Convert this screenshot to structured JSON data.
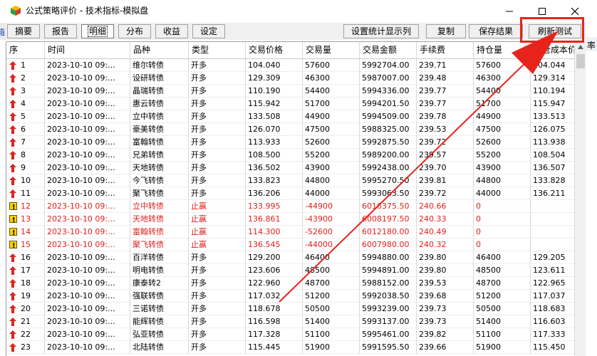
{
  "window": {
    "title": "公式策略评价 - 技术指标-模拟盘",
    "left_fragment": "箱",
    "right_fragment": "率"
  },
  "toolbar": {
    "tabs": [
      "摘要",
      "报告",
      "明细",
      "分布",
      "收益",
      "设定"
    ],
    "active_tab": "明细",
    "buttons": [
      "设置统计显示列",
      "复制",
      "保存结果",
      "刷新测试"
    ]
  },
  "table": {
    "columns": [
      "序",
      "时间",
      "品种",
      "类型",
      "交易价格",
      "交易量",
      "交易金额",
      "手续费",
      "持仓量",
      "持仓成本价"
    ],
    "rows": [
      {
        "icon": "up-arrow",
        "seq": "1",
        "time": "2023-10-10 09:...",
        "name": "维尔转债",
        "type": "开多",
        "price": "104.040",
        "volume": "57600",
        "amount": "5992704.00",
        "fee": "239.71",
        "position": "57600",
        "cost": "104.044",
        "red": false
      },
      {
        "icon": "up-arrow",
        "seq": "2",
        "time": "2023-10-10 09:...",
        "name": "设研转债",
        "type": "开多",
        "price": "129.309",
        "volume": "46300",
        "amount": "5987007.00",
        "fee": "239.48",
        "position": "46300",
        "cost": "129.314",
        "red": false
      },
      {
        "icon": "up-arrow",
        "seq": "3",
        "time": "2023-10-10 09:...",
        "name": "晶瑞转债",
        "type": "开多",
        "price": "110.190",
        "volume": "54400",
        "amount": "5994336.00",
        "fee": "239.77",
        "position": "54400",
        "cost": "110.194",
        "red": false
      },
      {
        "icon": "up-arrow",
        "seq": "4",
        "time": "2023-10-10 09:...",
        "name": "惠云转债",
        "type": "开多",
        "price": "115.942",
        "volume": "51700",
        "amount": "5994201.50",
        "fee": "239.77",
        "position": "51700",
        "cost": "115.947",
        "red": false
      },
      {
        "icon": "up-arrow",
        "seq": "5",
        "time": "2023-10-10 09:...",
        "name": "立中转债",
        "type": "开多",
        "price": "133.508",
        "volume": "44900",
        "amount": "5994509.00",
        "fee": "239.78",
        "position": "44900",
        "cost": "133.513",
        "red": false
      },
      {
        "icon": "up-arrow",
        "seq": "6",
        "time": "2023-10-10 09:...",
        "name": "豪美转债",
        "type": "开多",
        "price": "126.070",
        "volume": "47500",
        "amount": "5988325.00",
        "fee": "239.53",
        "position": "47500",
        "cost": "126.075",
        "red": false
      },
      {
        "icon": "up-arrow",
        "seq": "7",
        "time": "2023-10-10 09:...",
        "name": "富翰转债",
        "type": "开多",
        "price": "113.933",
        "volume": "52600",
        "amount": "5992875.50",
        "fee": "239.72",
        "position": "52600",
        "cost": "113.938",
        "red": false
      },
      {
        "icon": "up-arrow",
        "seq": "8",
        "time": "2023-10-10 09:...",
        "name": "兄弟转债",
        "type": "开多",
        "price": "108.500",
        "volume": "55200",
        "amount": "5989200.00",
        "fee": "239.57",
        "position": "55200",
        "cost": "108.504",
        "red": false
      },
      {
        "icon": "up-arrow",
        "seq": "9",
        "time": "2023-10-10 09:...",
        "name": "天地转债",
        "type": "开多",
        "price": "136.502",
        "volume": "43900",
        "amount": "5992438.00",
        "fee": "239.70",
        "position": "43900",
        "cost": "136.507",
        "red": false
      },
      {
        "icon": "up-arrow",
        "seq": "10",
        "time": "2023-10-10 09:...",
        "name": "今飞转债",
        "type": "开多",
        "price": "133.823",
        "volume": "44800",
        "amount": "5995270.50",
        "fee": "239.81",
        "position": "44800",
        "cost": "133.828",
        "red": false
      },
      {
        "icon": "up-arrow",
        "seq": "11",
        "time": "2023-10-10 09:...",
        "name": "聚飞转债",
        "type": "开多",
        "price": "136.206",
        "volume": "44000",
        "amount": "5993063.50",
        "fee": "239.72",
        "position": "44000",
        "cost": "136.211",
        "red": false
      },
      {
        "icon": "warning",
        "seq": "12",
        "time": "2023-10-10 09:...",
        "name": "立中转债",
        "type": "止赢",
        "price": "133.995",
        "volume": "-44900",
        "amount": "6016375.50",
        "fee": "240.66",
        "position": "0",
        "cost": "",
        "red": true
      },
      {
        "icon": "warning",
        "seq": "13",
        "time": "2023-10-10 09:...",
        "name": "天地转债",
        "type": "止赢",
        "price": "136.861",
        "volume": "-43900",
        "amount": "6008197.50",
        "fee": "240.33",
        "position": "0",
        "cost": "",
        "red": true
      },
      {
        "icon": "warning",
        "seq": "14",
        "time": "2023-10-10 09:...",
        "name": "富翰转债",
        "type": "止赢",
        "price": "114.300",
        "volume": "-52600",
        "amount": "6012180.00",
        "fee": "240.49",
        "position": "0",
        "cost": "",
        "red": true
      },
      {
        "icon": "warning",
        "seq": "15",
        "time": "2023-10-10 09:...",
        "name": "聚飞转债",
        "type": "止赢",
        "price": "136.545",
        "volume": "-44000",
        "amount": "6007980.00",
        "fee": "240.32",
        "position": "0",
        "cost": "",
        "red": true
      },
      {
        "icon": "up-arrow",
        "seq": "16",
        "time": "2023-10-10 09:...",
        "name": "百洋转债",
        "type": "开多",
        "price": "129.200",
        "volume": "46400",
        "amount": "5994880.00",
        "fee": "239.80",
        "position": "46400",
        "cost": "129.205",
        "red": false
      },
      {
        "icon": "up-arrow",
        "seq": "17",
        "time": "2023-10-10 09:...",
        "name": "明电转债",
        "type": "开多",
        "price": "123.606",
        "volume": "48500",
        "amount": "5994891.00",
        "fee": "239.80",
        "position": "48500",
        "cost": "123.611",
        "red": false
      },
      {
        "icon": "up-arrow",
        "seq": "18",
        "time": "2023-10-10 09:...",
        "name": "康泰转2",
        "type": "开多",
        "price": "122.960",
        "volume": "48700",
        "amount": "5988152.00",
        "fee": "239.53",
        "position": "48700",
        "cost": "122.965",
        "red": false
      },
      {
        "icon": "up-arrow",
        "seq": "19",
        "time": "2023-10-10 09:...",
        "name": "强联转债",
        "type": "开多",
        "price": "117.032",
        "volume": "51200",
        "amount": "5992038.50",
        "fee": "239.68",
        "position": "51200",
        "cost": "117.037",
        "red": false
      },
      {
        "icon": "up-arrow",
        "seq": "20",
        "time": "2023-10-10 09:...",
        "name": "三诺转债",
        "type": "开多",
        "price": "118.678",
        "volume": "50500",
        "amount": "5993239.00",
        "fee": "239.73",
        "position": "50500",
        "cost": "118.683",
        "red": false
      },
      {
        "icon": "up-arrow",
        "seq": "21",
        "time": "2023-10-10 09:...",
        "name": "能辉转债",
        "type": "开多",
        "price": "116.598",
        "volume": "51400",
        "amount": "5993137.00",
        "fee": "239.73",
        "position": "51400",
        "cost": "116.603",
        "red": false
      },
      {
        "icon": "up-arrow",
        "seq": "22",
        "time": "2023-10-10 09:...",
        "name": "弘亚转债",
        "type": "开多",
        "price": "117.328",
        "volume": "51100",
        "amount": "5995461.00",
        "fee": "239.82",
        "position": "51100",
        "cost": "117.333",
        "red": false
      },
      {
        "icon": "up-arrow",
        "seq": "23",
        "time": "2023-10-10 09:...",
        "name": "北陆转债",
        "type": "开多",
        "price": "115.445",
        "volume": "51900",
        "amount": "5991595.50",
        "fee": "239.66",
        "position": "51900",
        "cost": "115.450",
        "red": false
      }
    ]
  },
  "colors": {
    "profit_text": "#e0201c",
    "annotation": "#e8231c",
    "up_arrow": "#d9261c",
    "warning_icon": "#f5d200"
  }
}
